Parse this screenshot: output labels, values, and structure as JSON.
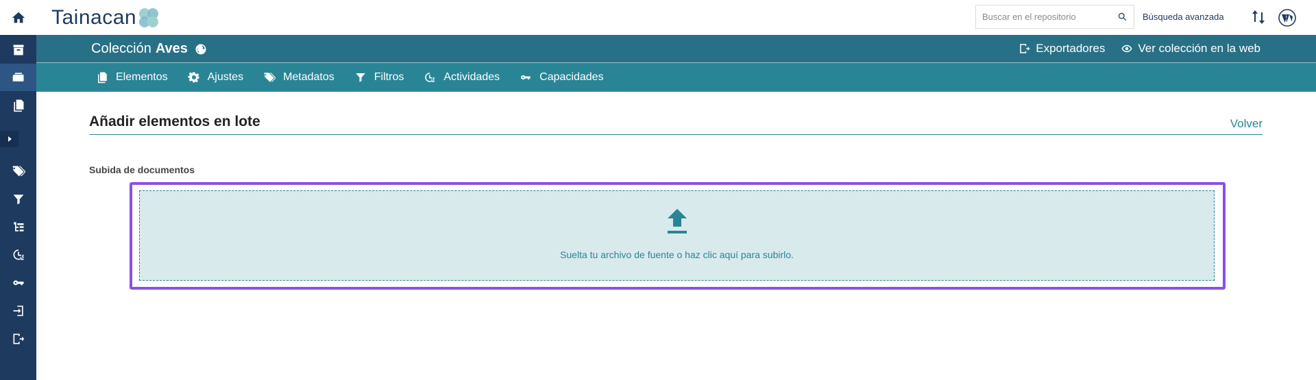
{
  "app": {
    "logo_text": "Tainacan"
  },
  "sidebar": {
    "items": [
      {
        "name": "home-icon"
      },
      {
        "name": "repository-icon"
      },
      {
        "name": "collections-icon"
      },
      {
        "name": "items-icon"
      },
      {
        "name": "taxonomies-icon"
      },
      {
        "name": "filters-icon"
      },
      {
        "name": "hierarchy-icon"
      },
      {
        "name": "activities-icon"
      },
      {
        "name": "key-icon"
      },
      {
        "name": "importers-icon"
      },
      {
        "name": "exporters-icon"
      }
    ]
  },
  "topbar": {
    "search_placeholder": "Buscar en el repositorio",
    "advanced_search": "Búsqueda avanzada"
  },
  "collection": {
    "prefix": "Colección",
    "name": "Aves",
    "exporters": "Exportadores",
    "view_web": "Ver colección en la web"
  },
  "tabs": [
    {
      "label": "Elementos",
      "icon": "items-icon"
    },
    {
      "label": "Ajustes",
      "icon": "gear-icon"
    },
    {
      "label": "Metadatos",
      "icon": "tags-icon"
    },
    {
      "label": "Filtros",
      "icon": "filter-icon"
    },
    {
      "label": "Actividades",
      "icon": "activities-icon"
    },
    {
      "label": "Capacidades",
      "icon": "key-icon"
    }
  ],
  "main": {
    "title": "Añadir elementos en lote",
    "back": "Volver",
    "section_label": "Subida de documentos",
    "dropzone_text": "Suelta tu archivo de fuente o haz clic aquí para subirlo."
  },
  "colors": {
    "sidebar": "#1e3a5f",
    "header": "#287085",
    "tabs": "#298596",
    "highlight": "#8b4fe4",
    "dropzone": "#d8eaec"
  }
}
